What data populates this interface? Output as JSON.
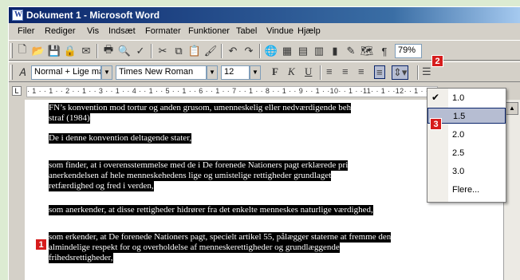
{
  "window": {
    "title": "Dokument 1 - Microsoft Word"
  },
  "menu": [
    "Filer",
    "Rediger",
    "Vis",
    "Indsæt",
    "Formater",
    "Funktioner",
    "Tabel",
    "Vindue",
    "Hjælp"
  ],
  "toolbar": {
    "zoom": "79%",
    "style": "Normal + Lige ma",
    "font": "Times New Roman",
    "size": "12",
    "bold": "F",
    "italic": "K",
    "underline": "U"
  },
  "ruler": {
    "scale": "· 1 · · 1 · · 2 · · 1 · · 3 · · 1 · · 4 · · 1 · · 5 · · 1 · · 6 · · 1 · · 7 · · 1 · · 8 · · 1 · · 9 · · 1 · ·10· · 1 · ·11· · 1 · ·12· · 1 · ·13· · 1 · ·14· · 1 · ·15"
  },
  "document": {
    "lines": [
      "FN’s konvention mod tortur og anden grusom, umenneskelig eller nedværdigende beh",
      "straf (1984)",
      "De i denne konvention deltagende stater,",
      "som finder, at i overensstemmelse med de i De forenede Nationers pagt erklærede pri",
      "anerkendelsen af hele menneskehedens lige og umistelige rettigheder grundlaget",
      "retfærdighed og fred i verden,",
      "som anerkender, at disse rettigheder hidrører fra det enkelte menneskes naturlige værdighed,",
      "som erkender, at De forenede Nationers pagt, specielt artikel 55, pålægger staterne at fremme den",
      "almindelige respekt for og overholdelse af menneskerettigheder og grundlæggende",
      "frihedsrettigheder,"
    ]
  },
  "line_spacing_menu": {
    "options": [
      "1.0",
      "1.5",
      "2.0",
      "2.5",
      "3.0",
      "Flere..."
    ],
    "checked": "1.0",
    "highlighted": "1.5"
  },
  "callouts": [
    "1",
    "2",
    "3"
  ]
}
